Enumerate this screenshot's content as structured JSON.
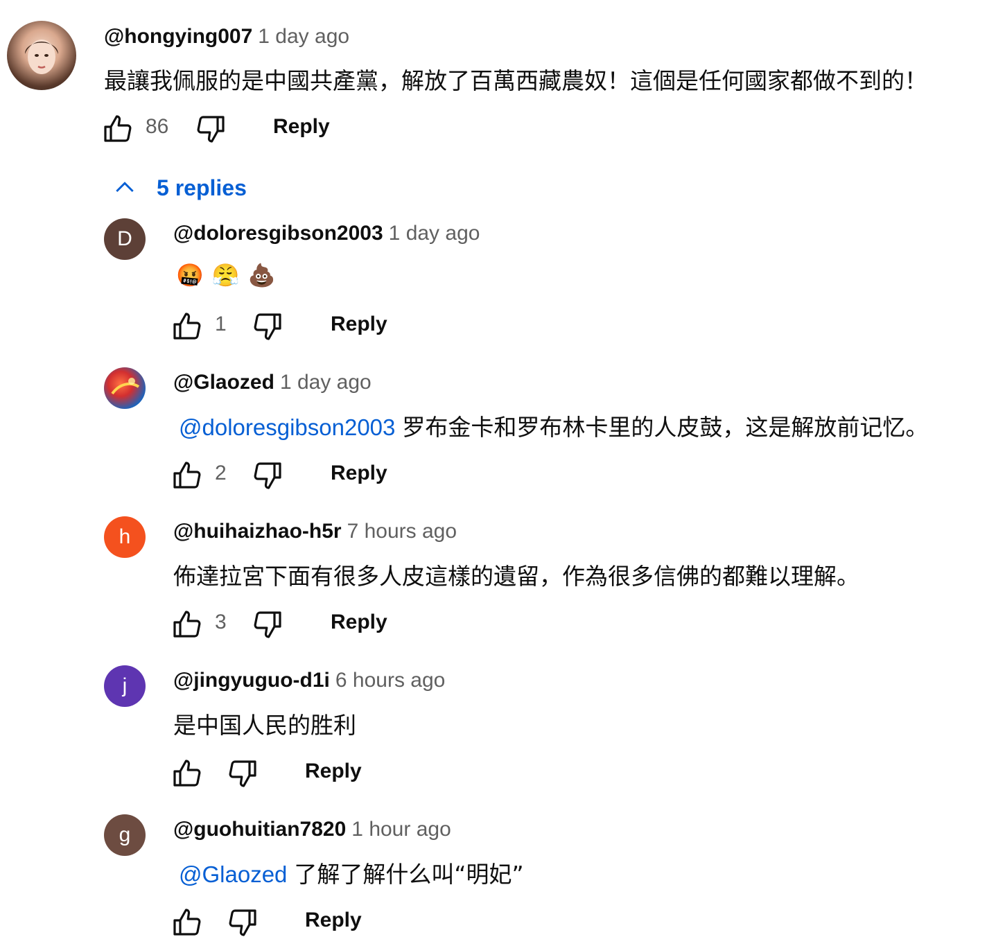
{
  "top_comment": {
    "author": "@hongying007",
    "time": "1 day ago",
    "text": "最讓我佩服的是中國共產黨，解放了百萬西藏農奴！這個是任何國家都做不到的！",
    "likes": "86",
    "reply_label": "Reply"
  },
  "replies_toggle": {
    "label": "5 replies"
  },
  "replies": [
    {
      "avatar_letter": "D",
      "avatar_color": "#5d4037",
      "author": "@doloresgibson2003",
      "time": "1 day ago",
      "emoji": [
        "🤬",
        "😤",
        "💩"
      ],
      "likes": "1",
      "reply_label": "Reply"
    },
    {
      "avatar_letter": "",
      "avatar_color": "#d32f2f",
      "author": "@Glaozed",
      "time": "1 day ago",
      "mention": "@doloresgibson2003",
      "text": "罗布金卡和罗布林卡里的人皮鼓，这是解放前记忆。",
      "likes": "2",
      "reply_label": "Reply"
    },
    {
      "avatar_letter": "h",
      "avatar_color": "#f4511e",
      "author": "@huihaizhao-h5r",
      "time": "7 hours ago",
      "text": "佈達拉宮下面有很多人皮這樣的遺留，作為很多信佛的都難以理解。",
      "likes": "3",
      "reply_label": "Reply"
    },
    {
      "avatar_letter": "j",
      "avatar_color": "#5e35b1",
      "author": "@jingyuguo-d1i",
      "time": "6 hours ago",
      "text": "是中国人民的胜利",
      "likes": "",
      "reply_label": "Reply"
    },
    {
      "avatar_letter": "g",
      "avatar_color": "#6d4c41",
      "author": "@guohuitian7820",
      "time": "1 hour ago",
      "mention": "@Glaozed",
      "text": "了解了解什么叫“明妃”",
      "likes": "",
      "reply_label": "Reply"
    }
  ]
}
